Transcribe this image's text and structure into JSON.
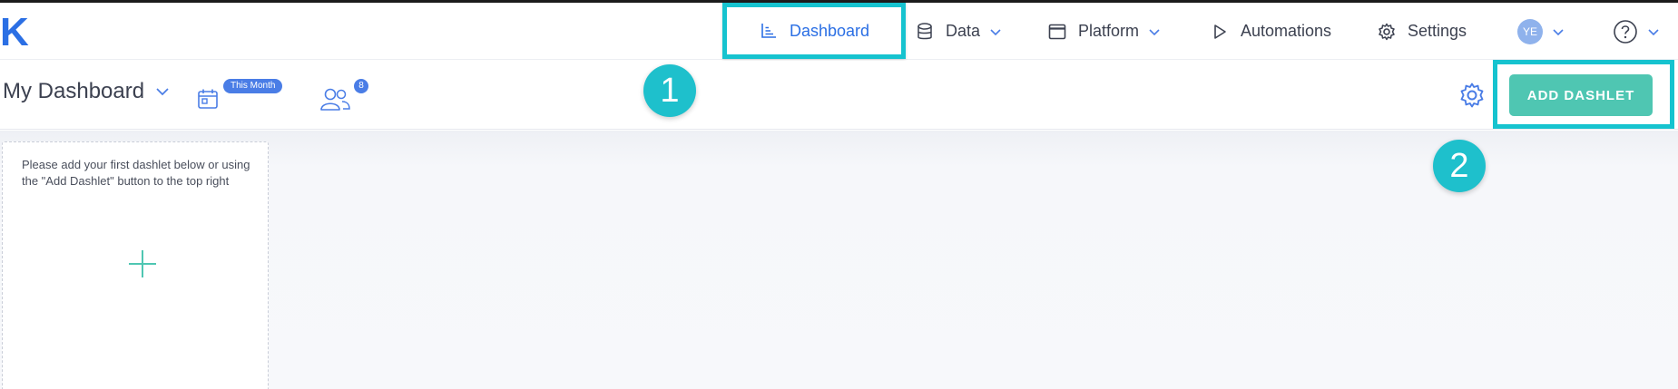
{
  "logo": {
    "text": "K"
  },
  "nav": {
    "dashboard": "Dashboard",
    "data": "Data",
    "platform": "Platform",
    "automations": "Automations",
    "settings": "Settings",
    "user_initials": "YE"
  },
  "subheader": {
    "title": "My Dashboard",
    "date_badge": "This Month",
    "users_count": "8",
    "add_button": "ADD DASHLET"
  },
  "steps": {
    "one": "1",
    "two": "2"
  },
  "dashlet": {
    "hint": "Please add your first dashlet below or using the \"Add Dashlet\" button to the top right"
  },
  "colors": {
    "brand_blue": "#2b6fe4",
    "highlight_cyan": "#16c3cf",
    "add_button_green": "#4fc6b2",
    "badge_blue": "#4a7de6"
  },
  "icons": [
    "dashboard-chart-icon",
    "database-icon",
    "window-icon",
    "play-icon",
    "gear-icon",
    "help-icon",
    "chevron-down-icon",
    "calendar-icon",
    "users-icon",
    "plus-icon"
  ]
}
